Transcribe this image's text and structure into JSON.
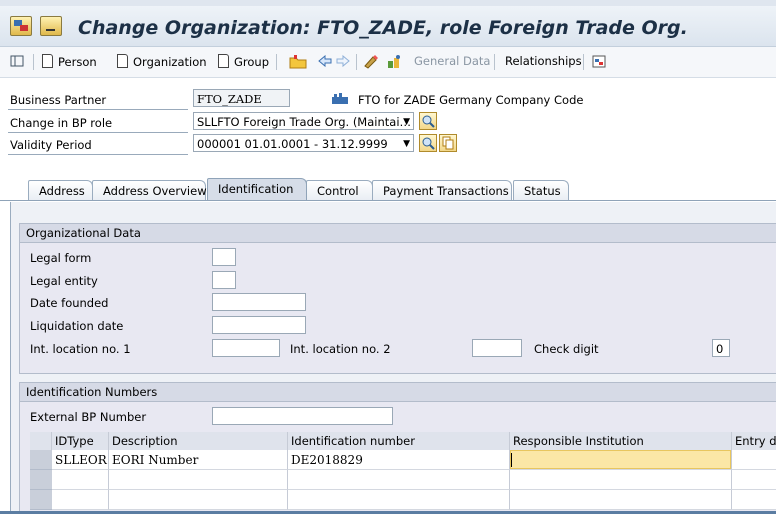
{
  "window": {
    "title": "Change Organization: FTO_ZADE, role Foreign Trade Org."
  },
  "toolbar": {
    "person": "Person",
    "organization": "Organization",
    "group": "Group",
    "general_data": "General Data",
    "relationships": "Relationships"
  },
  "header": {
    "bp_label": "Business Partner",
    "bp_value": "FTO_ZADE",
    "bp_desc": "FTO for ZADE Germany Company Code",
    "role_label": "Change in BP role",
    "role_value": "SLLFTO Foreign Trade Org. (Maintai…",
    "validity_label": "Validity Period",
    "validity_value": "000001 01.01.0001 - 31.12.9999"
  },
  "tabs": [
    "Address",
    "Address Overview",
    "Identification",
    "Control",
    "Payment Transactions",
    "Status"
  ],
  "org_data": {
    "title": "Organizational Data",
    "legal_form": "Legal form",
    "legal_entity": "Legal entity",
    "date_founded": "Date founded",
    "liquidation_date": "Liquidation date",
    "int_loc1": "Int. location no. 1",
    "int_loc2": "Int. location no. 2",
    "check_digit": "Check digit",
    "check_digit_value": "0"
  },
  "id_numbers": {
    "title": "Identification Numbers",
    "external_bp_label": "External BP Number",
    "columns": [
      "IDType",
      "Description",
      "Identification number",
      "Responsible Institution",
      "Entry da"
    ],
    "rows": [
      [
        "SLLEOR",
        "EORI Number",
        "DE2018829",
        "",
        ""
      ]
    ]
  }
}
